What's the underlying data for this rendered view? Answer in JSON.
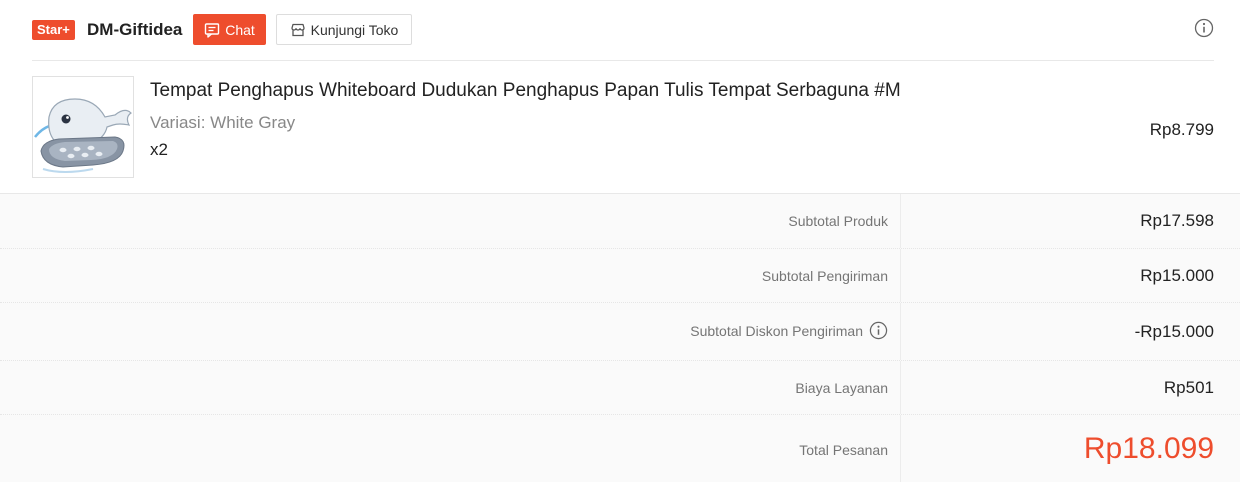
{
  "shop": {
    "badge": "Star+",
    "name": "DM-Giftidea",
    "chat_label": "Chat",
    "visit_label": "Kunjungi Toko"
  },
  "product": {
    "title": "Tempat Penghapus Whiteboard Dudukan Penghapus Papan Tulis Tempat Serbaguna #M",
    "variant": "Variasi: White Gray",
    "quantity": "x2",
    "price": "Rp8.799"
  },
  "summary": {
    "rows": [
      {
        "label": "Subtotal Produk",
        "value": "Rp17.598"
      },
      {
        "label": "Subtotal Pengiriman",
        "value": "Rp15.000"
      },
      {
        "label": "Subtotal Diskon Pengiriman",
        "value": "-Rp15.000"
      },
      {
        "label": "Biaya Layanan",
        "value": "Rp501"
      },
      {
        "label": "Total Pesanan",
        "value": "Rp18.099"
      }
    ]
  },
  "icons": {
    "chat": "chat-icon",
    "shop": "shop-icon",
    "info": "info-icon"
  },
  "colors": {
    "accent": "#ee4d2d",
    "summary_bg": "#fafafa"
  }
}
